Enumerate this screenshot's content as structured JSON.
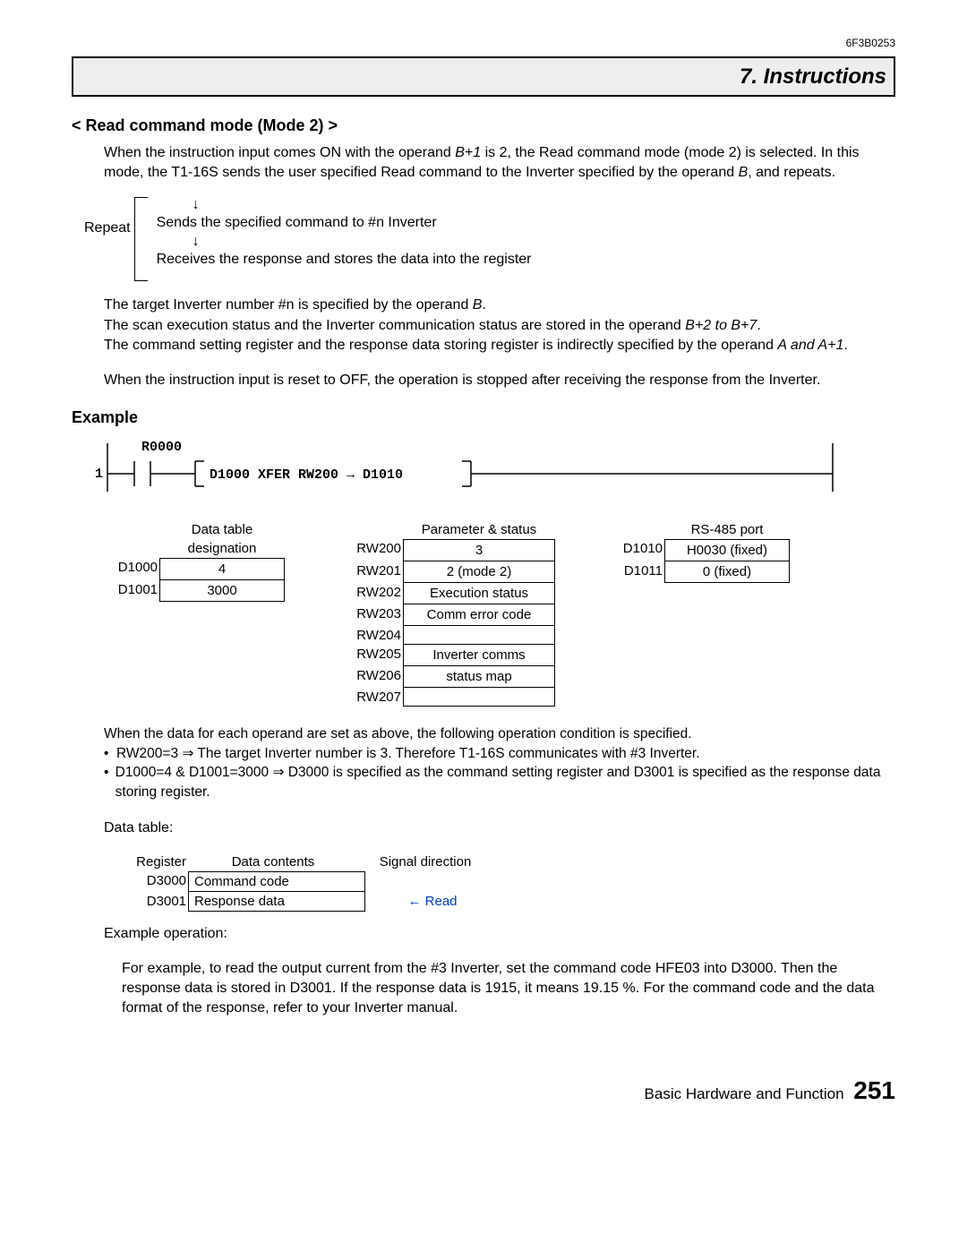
{
  "doc_code": "6F3B0253",
  "chapter_title": "7. Instructions",
  "section_title": "< Read command mode (Mode 2) >",
  "para1_a": "When the instruction input comes ON with the operand ",
  "para1_b": " is 2, the Read command mode (mode 2) is selected. In this mode, the T1-16S sends the user specified Read command to the Inverter specified by the operand ",
  "para1_c": ", and repeats.",
  "op_b1": "B+1",
  "op_b": "B",
  "repeat_label": "Repeat",
  "repeat_line1": "Sends the specified command to #n Inverter",
  "repeat_line2": "Receives the response and stores the data into the register",
  "arrow_glyph": "↓",
  "para2_a": "The target Inverter number #n is specified by the operand ",
  "para2_b": ".",
  "para3_a": "The scan execution status and the Inverter communication status are stored in the operand ",
  "para3_range": "B+2 to B+7",
  "para3_b": ".",
  "para4_a": "The command setting register and the response data storing register is indirectly specified by the operand ",
  "para4_ops": "A and A+1",
  "para4_b": ".",
  "para5": "When the instruction input is reset to OFF, the operation is stopped after receiving the response from the Inverter.",
  "example_head": "Example",
  "ladder": {
    "r_label": "R0000",
    "rung_num": "1",
    "box_text": "D1000  XFER   RW200   →   D1010"
  },
  "tables": {
    "t1": {
      "title": "Data table designation",
      "rows": [
        {
          "lbl": "D1000",
          "val": "4"
        },
        {
          "lbl": "D1001",
          "val": "3000"
        }
      ]
    },
    "t2": {
      "title": "Parameter & status",
      "rows": [
        {
          "lbl": "RW200",
          "val": "3"
        },
        {
          "lbl": "RW201",
          "val": "2 (mode 2)"
        },
        {
          "lbl": "RW202",
          "val": "Execution status"
        },
        {
          "lbl": "RW203",
          "val": "Comm error code"
        },
        {
          "lbl": "RW204",
          "val": ""
        },
        {
          "lbl": "RW205",
          "val": "Inverter comms"
        },
        {
          "lbl": "RW206",
          "val": "status map"
        },
        {
          "lbl": "RW207",
          "val": ""
        }
      ]
    },
    "t3": {
      "title": "RS-485 port",
      "rows": [
        {
          "lbl": "D1010",
          "val": "H0030 (fixed)"
        },
        {
          "lbl": "D1011",
          "val": "0 (fixed)"
        }
      ]
    }
  },
  "cond_intro": "When the data for each operand are set as above, the following operation condition is specified.",
  "bullet1": "RW200=3 ⇒ The target Inverter number is 3. Therefore T1-16S communicates with #3 Inverter.",
  "bullet2": "D1000=4 & D1001=3000 ⇒ D3000 is specified as the command setting register and D3001 is specified as the response data storing register.",
  "data_table_head": "Data table:",
  "datatable": {
    "h1": "Register",
    "h2": "Data contents",
    "h3": "Signal direction",
    "rows": [
      {
        "reg": "D3000",
        "cont": "Command code",
        "dir": ""
      },
      {
        "reg": "D3001",
        "cont": "Response data",
        "dir": "← Read"
      }
    ]
  },
  "example_op_head": "Example operation:",
  "example_op_text": "For example, to read the output current from the #3 Inverter, set the command code HFE03 into D3000. Then the response data is stored in D3001. If the response data is 1915, it means 19.15 %. For the command code and the data format of the response, refer to your Inverter manual.",
  "footer_text": "Basic Hardware and Function",
  "page_number": "251"
}
